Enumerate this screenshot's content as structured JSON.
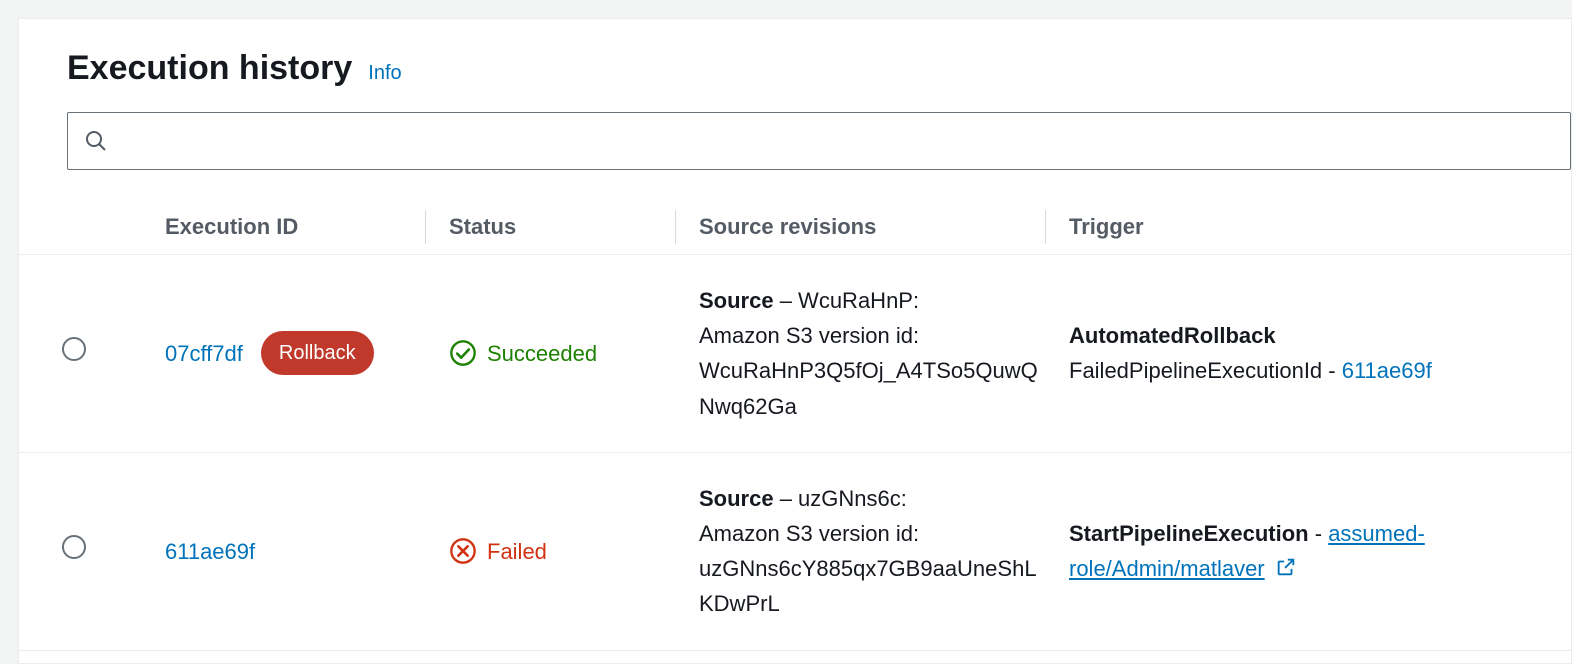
{
  "header": {
    "title": "Execution history",
    "info_label": "Info"
  },
  "search": {
    "placeholder": ""
  },
  "columns": {
    "execution_id": "Execution ID",
    "status": "Status",
    "source_revisions": "Source revisions",
    "trigger": "Trigger"
  },
  "status_labels": {
    "succeeded": "Succeeded",
    "failed": "Failed"
  },
  "badge_labels": {
    "rollback": "Rollback"
  },
  "rows": [
    {
      "id": "07cff7df",
      "badge": "rollback",
      "status": "succeeded",
      "source": {
        "label": "Source",
        "name": "WcuRaHnP",
        "desc_prefix": "Amazon S3 version id:",
        "version_id": "WcuRaHnP3Q5fOj_A4TSo5QuwQNwq62Ga"
      },
      "trigger": {
        "name": "AutomatedRollback",
        "detail_label": "FailedPipelineExecutionId",
        "link_text": "611ae69f",
        "link_underline": false,
        "external": false
      }
    },
    {
      "id": "611ae69f",
      "badge": null,
      "status": "failed",
      "source": {
        "label": "Source",
        "name": "uzGNns6c",
        "desc_prefix": "Amazon S3 version id:",
        "version_id": "uzGNns6cY885qx7GB9aaUneShLKDwPrL"
      },
      "trigger": {
        "name": "StartPipelineExecution",
        "detail_label": null,
        "link_text": "assumed-role/Admin/matlaver",
        "link_underline": true,
        "external": true
      }
    }
  ]
}
